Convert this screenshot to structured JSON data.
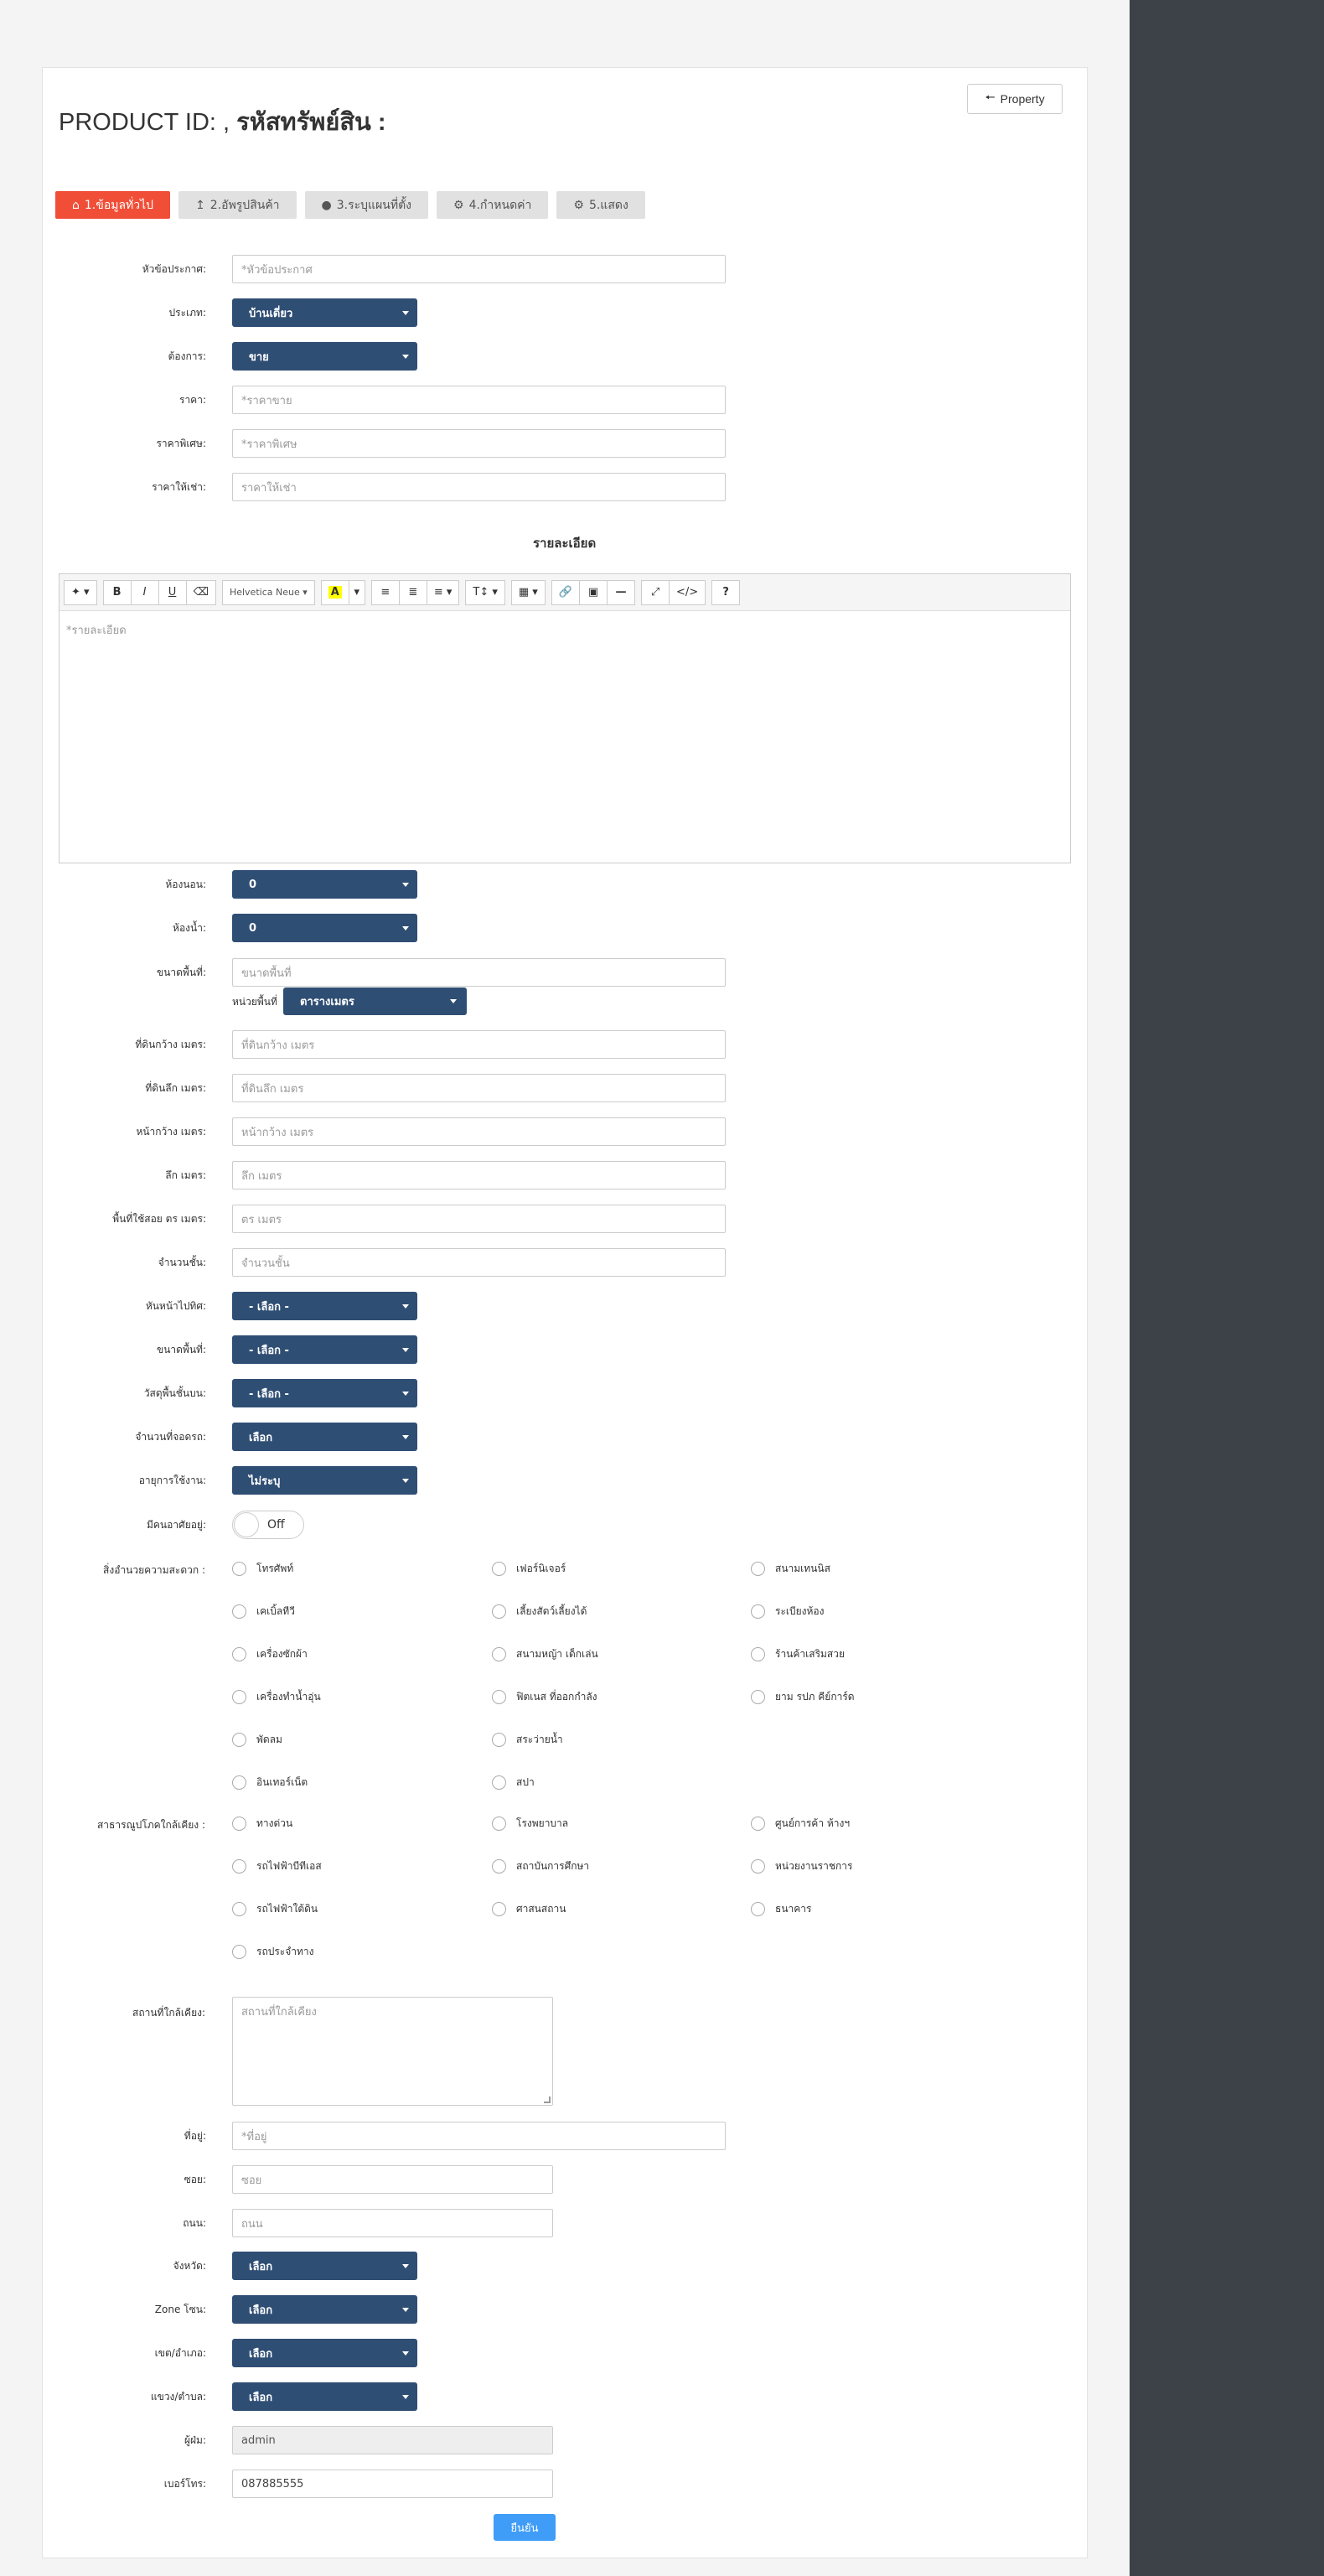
{
  "header": {
    "title_prefix": "PRODUCT ID: ,",
    "title_bold": "รหัสทรัพย์สิน :",
    "property_button": "Property"
  },
  "tabs": [
    {
      "label": "1.ข้อมูลทั่วไป",
      "icon": "home-icon"
    },
    {
      "label": "2.อัพรูปสินค้า",
      "icon": "upload-icon"
    },
    {
      "label": "3.ระบุแผนที่ตั้ง",
      "icon": "map-marker-icon"
    },
    {
      "label": "4.กำหนดค่า",
      "icon": "gear-icon"
    },
    {
      "label": "5.แสดง",
      "icon": "gear-icon"
    }
  ],
  "fields": {
    "announce_title": {
      "label": "หัวข้อประกาศ:",
      "placeholder": "*หัวข้อประกาศ"
    },
    "type": {
      "label": "ประเภท:",
      "value": "บ้านเดี่ยว"
    },
    "want": {
      "label": "ต้องการ:",
      "value": "ขาย"
    },
    "price": {
      "label": "ราคา:",
      "placeholder": "*ราคาขาย"
    },
    "special_price": {
      "label": "ราคาพิเศษ:",
      "placeholder": "*ราคาพิเศษ"
    },
    "rent_price": {
      "label": "ราคาให้เช่า:",
      "placeholder": "ราคาให้เช่า"
    }
  },
  "details": {
    "title": "รายละเอียด",
    "font_name": "Helvetica Neue",
    "placeholder": "*รายละเอียด"
  },
  "fields2": {
    "bedrooms": {
      "label": "ห้องนอน:",
      "value": "0"
    },
    "bathrooms": {
      "label": "ห้องน้ำ:",
      "value": "0"
    },
    "area": {
      "label": "ขนาดพื้นที่:",
      "placeholder": "ขนาดพื้นที่"
    },
    "area_unit_label": "หน่วยพื้นที่",
    "area_unit_value": "ตารางเมตร",
    "land_width": {
      "label": "ที่ดินกว้าง เมตร:",
      "placeholder": "ที่ดินกว้าง เมตร"
    },
    "land_depth": {
      "label": "ที่ดินลึก เมตร:",
      "placeholder": "ที่ดินลึก เมตร"
    },
    "front_width": {
      "label": "หน้ากว้าง เมตร:",
      "placeholder": "หน้ากว้าง เมตร"
    },
    "depth": {
      "label": "ลึก เมตร:",
      "placeholder": "ลึก เมตร"
    },
    "usable_area": {
      "label": "พื้นที่ใช้สอย ตร เมตร:",
      "placeholder": "ตร เมตร"
    },
    "floors": {
      "label": "จำนวนชั้น:",
      "placeholder": "จำนวนชั้น"
    },
    "facing": {
      "label": "หันหน้าไปทิศ:",
      "value": "- เลือก -"
    },
    "size": {
      "label": "ขนาดพื้นที่:",
      "value": "- เลือก -"
    },
    "floor_material": {
      "label": "วัสดุพื้นชั้นบน:",
      "value": "- เลือก -"
    },
    "parking": {
      "label": "จำนวนที่จอดรถ:",
      "value": "เลือก"
    },
    "age": {
      "label": "อายุการใช้งาน:",
      "value": "ไม่ระบุ"
    },
    "resident": {
      "label": "มีคนอาศัยอยู่:",
      "toggle": "Off"
    }
  },
  "facilities": {
    "label": "สิ่งอำนวยความสะดวก :",
    "items": [
      "โทรศัพท์",
      "เฟอร์นิเจอร์",
      "สนามเทนนิส",
      "เคเบิ้ลทีวี",
      "เลี้ยงสัตว์เลี้ยงได้",
      "ระเบียงห้อง",
      "เครื่องซักผ้า",
      "สนามหญ้า เด็กเล่น",
      "ร้านค้าเสริมสวย",
      "เครื่องทำน้ำอุ่น",
      "ฟิตเนส ที่ออกกำลัง",
      "ยาม รปภ คีย์การ์ด",
      "พัดลม",
      "สระว่ายน้ำ",
      "อินเทอร์เน็ต",
      "สปา"
    ]
  },
  "nearby": {
    "label": "สาธารณูปโภคใกล้เคียง :",
    "items": [
      "ทางด่วน",
      "โรงพยาบาล",
      "ศูนย์การค้า ห้างฯ",
      "รถไฟฟ้าบีทีเอส",
      "สถาบันการศึกษา",
      "หน่วยงานราชการ",
      "รถไฟฟ้าใต้ดิน",
      "ศาสนสถาน",
      "ธนาคาร",
      "รถประจำทาง"
    ]
  },
  "fields3": {
    "nearby_places": {
      "label": "สถานที่ใกล้เคียง:",
      "placeholder": "สถานที่ใกล้เคียง"
    },
    "address": {
      "label": "ที่อยู่:",
      "placeholder": "*ที่อยู่"
    },
    "soi": {
      "label": "ซอย:",
      "placeholder": "ซอย"
    },
    "road": {
      "label": "ถนน:",
      "placeholder": "ถนน"
    },
    "province": {
      "label": "จังหวัด:",
      "value": "เลือก"
    },
    "zone": {
      "label": "Zone โซน:",
      "value": "เลือก"
    },
    "district": {
      "label": "เขต/อำเภอ:",
      "value": "เลือก"
    },
    "subdistrict": {
      "label": "แขวง/ตำบล:",
      "value": "เลือก"
    },
    "poster": {
      "label": "ผู้ฝ่ม:",
      "value": "admin"
    },
    "phone": {
      "label": "เบอร์โทร:",
      "value": "087885555"
    }
  },
  "submit_label": "ยืนยัน"
}
